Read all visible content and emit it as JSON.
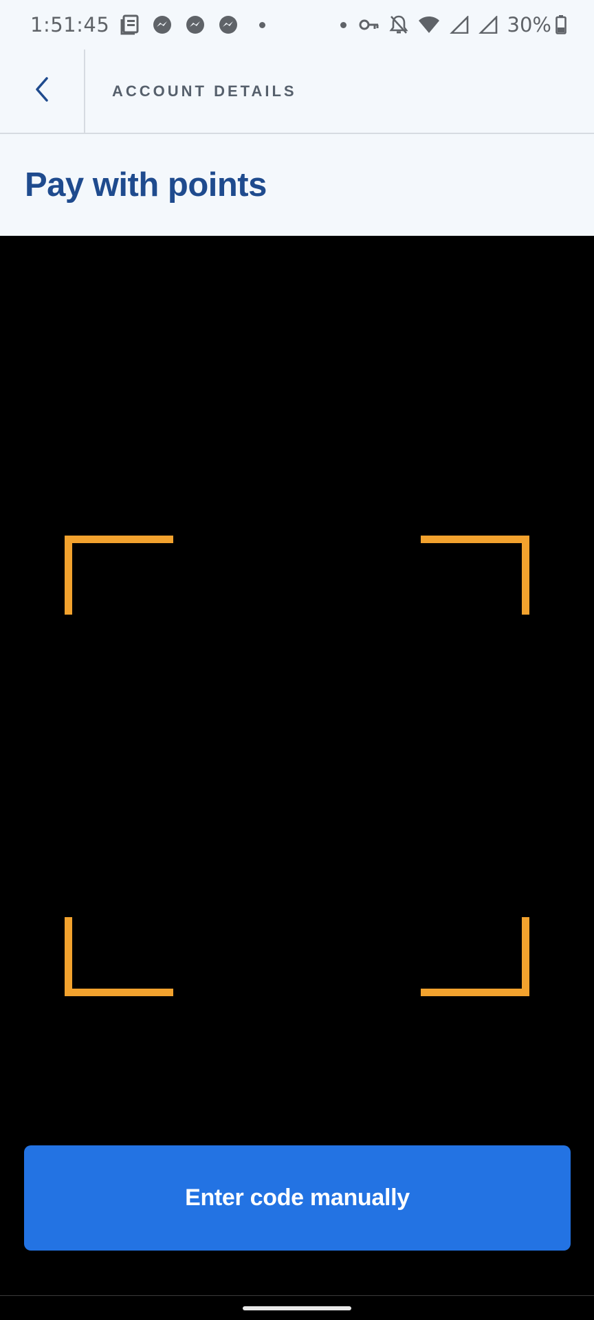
{
  "status_bar": {
    "time": "1:51:45",
    "battery_percent": "30%",
    "icons_left": [
      "news-icon",
      "messenger-icon",
      "messenger-icon",
      "messenger-icon",
      "dot-icon"
    ],
    "icons_right": [
      "dot-icon",
      "vpn-key-icon",
      "notifications-off-icon",
      "wifi-icon",
      "signal-icon",
      "signal-icon",
      "battery-icon"
    ]
  },
  "header": {
    "title": "ACCOUNT DETAILS",
    "back_icon": "chevron-left-icon"
  },
  "page": {
    "title": "Pay with points"
  },
  "scanner": {
    "frame_color": "#f2a22e",
    "button_label": "Enter code manually",
    "button_color": "#2373e3"
  },
  "colors": {
    "title_blue": "#1f4b8e",
    "header_text": "#56606c",
    "surface": "#f4f8fc"
  }
}
